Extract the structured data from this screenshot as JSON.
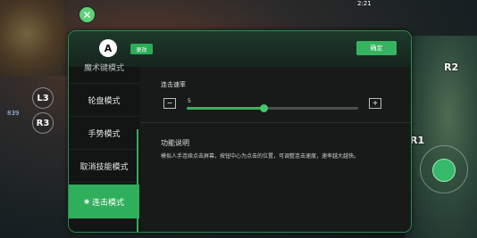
{
  "background": {
    "left_labels": [
      "L3",
      "R3"
    ],
    "right_labels": [
      "R2",
      "R1"
    ],
    "coin_text": "839",
    "top_number": "2:21"
  },
  "header": {
    "avatar_letter": "A",
    "change_label": "更改",
    "confirm_label": "确定"
  },
  "sidebar": {
    "items": [
      {
        "label": "魔术键模式"
      },
      {
        "label": "轮盘模式"
      },
      {
        "label": "手势模式"
      },
      {
        "label": "取消技能模式"
      },
      {
        "label": "连击模式",
        "active": true
      }
    ]
  },
  "rate": {
    "title": "连击速率",
    "value": "5",
    "min_label": "−",
    "max_label": "+",
    "fraction": 0.45
  },
  "info": {
    "title": "功能说明",
    "text": "模拟人手连续点击屏幕，按钮中心为点击的位置，可调整连击速度，速率越大越快。"
  },
  "colors": {
    "accent": "#2fae5c",
    "border": "#2f8a52"
  }
}
